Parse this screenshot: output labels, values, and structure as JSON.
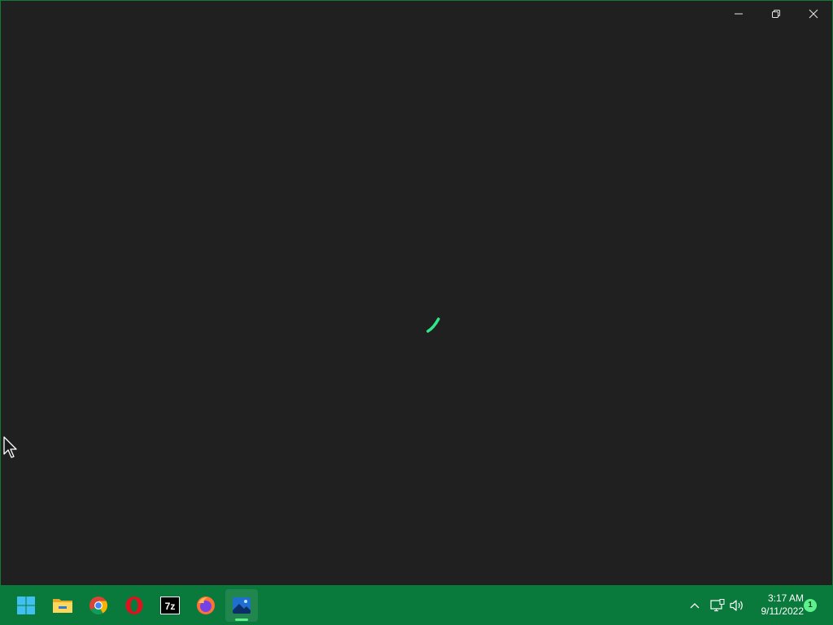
{
  "window": {
    "background_color": "#202020",
    "controls": {
      "minimize": "minimize-icon",
      "restore": "restore-icon",
      "close": "close-icon"
    },
    "loading_indicator": "spinner-icon",
    "accent_color": "#2ee88a"
  },
  "taskbar": {
    "background_color": "#0a7a3c",
    "pinned": [
      {
        "name": "start",
        "icon": "windows-logo-icon"
      },
      {
        "name": "file-explorer",
        "icon": "folder-icon"
      },
      {
        "name": "google-chrome",
        "icon": "chrome-icon"
      },
      {
        "name": "opera",
        "icon": "opera-icon"
      },
      {
        "name": "7-zip",
        "icon": "7zip-icon",
        "label": "7z"
      },
      {
        "name": "firefox",
        "icon": "firefox-icon"
      },
      {
        "name": "photos",
        "icon": "photos-icon",
        "active": true
      }
    ],
    "tray": {
      "overflow_icon": "chevron-up-icon",
      "network_icon": "network-icon",
      "volume_icon": "volume-icon"
    },
    "clock": {
      "time": "3:17 AM",
      "date": "9/11/2022"
    },
    "notification_count": "1"
  }
}
